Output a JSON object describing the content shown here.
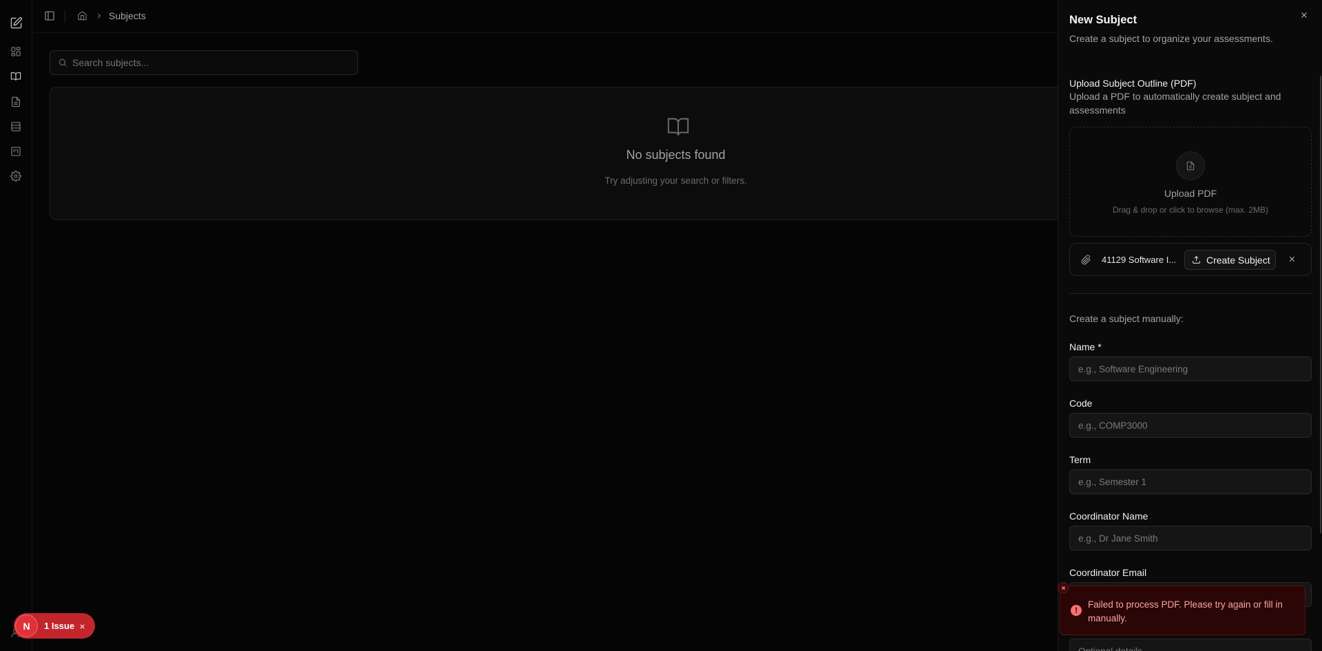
{
  "breadcrumb": {
    "current": "Subjects"
  },
  "search": {
    "placeholder": "Search subjects..."
  },
  "empty_state": {
    "title": "No subjects found",
    "subtitle": "Try adjusting your search or filters."
  },
  "rail": {
    "icons": [
      "logo-icon",
      "dashboard-icon",
      "book-icon",
      "document-icon",
      "table-icon",
      "board-icon",
      "gear-icon"
    ]
  },
  "drawer": {
    "title": "New Subject",
    "subtitle": "Create a subject to organize your assessments.",
    "upload_title": "Upload Subject Outline (PDF)",
    "upload_desc": "Upload a PDF to automatically create subject and assessments",
    "dropzone_title": "Upload PDF",
    "dropzone_hint": "Drag & drop or click to browse (max. 2MB)",
    "file_name": "41129 Software I...",
    "create_button": "Create Subject",
    "manual_label": "Create a subject manually:",
    "fields": {
      "name": {
        "label": "Name *",
        "placeholder": "e.g., Software Engineering"
      },
      "code": {
        "label": "Code",
        "placeholder": "e.g., COMP3000"
      },
      "term": {
        "label": "Term",
        "placeholder": "e.g., Semester 1"
      },
      "coordinator_name": {
        "label": "Coordinator Name",
        "placeholder": "e.g., Dr Jane Smith"
      },
      "coordinator_email": {
        "label": "Coordinator Email",
        "placeholder": ""
      },
      "details": {
        "placeholder": "Optional details"
      }
    }
  },
  "toast": {
    "message": "Failed to process PDF. Please try again or fill in manually."
  },
  "issue_badge": {
    "avatar": "N",
    "label": "1 Issue"
  },
  "colors": {
    "background": "#050505",
    "toast_bg": "#2a0606",
    "toast_text": "#fca5a5",
    "issue_red": "#c2262d"
  }
}
